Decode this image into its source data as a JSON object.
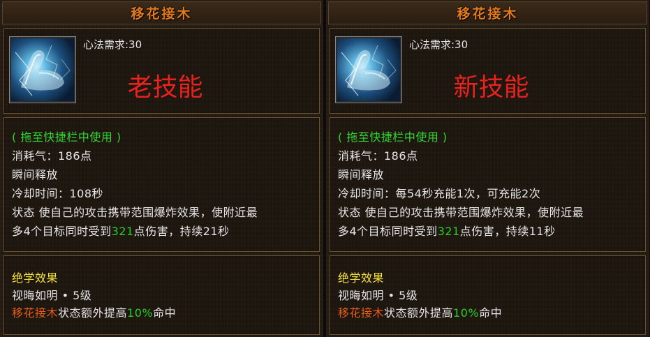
{
  "panels": [
    {
      "title": "移花接木",
      "requirement": "心法需求:30",
      "overlay_label": "老技能",
      "hint": "( 拖至快捷栏中使用 )",
      "cost": "消耗气：186点",
      "cast": "瞬间释放",
      "cooldown": "冷却时间：108秒",
      "desc_line1": "状态 使自己的攻击携带范围爆炸效果，使附近最",
      "desc_line2_pre": "多4个目标同时受到",
      "desc_line2_num": "321",
      "desc_line2_post": "点伤害，持续21秒",
      "ultimate_title": "绝学效果",
      "ultimate_level": "视晦如明 • 5级",
      "ultimate_effect_skill": "移花接木",
      "ultimate_effect_mid": "状态额外提高",
      "ultimate_effect_num": "10%",
      "ultimate_effect_post": "命中"
    },
    {
      "title": "移花接木",
      "requirement": "心法需求:30",
      "overlay_label": "新技能",
      "hint": "( 拖至快捷栏中使用 )",
      "cost": "消耗气：186点",
      "cast": "瞬间释放",
      "cooldown": "冷却时间：每54秒充能1次，可充能2次",
      "desc_line1": "状态 使自己的攻击携带范围爆炸效果，使附近最",
      "desc_line2_pre": "多4个目标同时受到",
      "desc_line2_num": "321",
      "desc_line2_post": "点伤害，持续11秒",
      "ultimate_title": "绝学效果",
      "ultimate_level": "视晦如明 • 5级",
      "ultimate_effect_skill": "移花接木",
      "ultimate_effect_mid": "状态额外提高",
      "ultimate_effect_num": "10%",
      "ultimate_effect_post": "命中"
    }
  ],
  "icon": "flexed-arm-skill-icon",
  "colors": {
    "title": "#e2791c",
    "overlay_label": "#e8221c",
    "hint": "#2fd82f",
    "ultimate_title": "#f4e23c",
    "skill_name_highlight": "#ea5d18",
    "number_highlight": "#24d024",
    "border": "#6a5430"
  }
}
